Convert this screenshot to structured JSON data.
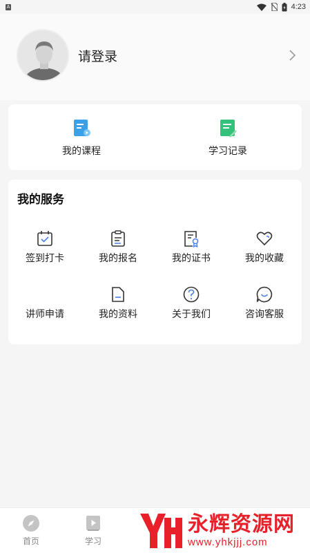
{
  "status_bar": {
    "notification_icon": "a-notification-icon",
    "time": "4:23"
  },
  "profile": {
    "login_label": "请登录",
    "avatar_icon": "avatar-person-icon",
    "chevron_icon": "chevron-right-icon"
  },
  "quick_actions": [
    {
      "label": "我的课程",
      "icon": "course-book-icon",
      "color": "#3aa0e8"
    },
    {
      "label": "学习记录",
      "icon": "study-note-icon",
      "color": "#34c27a"
    }
  ],
  "services": {
    "title": "我的服务",
    "items": [
      {
        "label": "签到打卡",
        "icon": "calendar-check-icon"
      },
      {
        "label": "我的报名",
        "icon": "clipboard-icon"
      },
      {
        "label": "我的证书",
        "icon": "certificate-icon"
      },
      {
        "label": "我的收藏",
        "icon": "heart-icon"
      },
      {
        "label": "讲师申请",
        "icon": ""
      },
      {
        "label": "我的资料",
        "icon": "folder-icon"
      },
      {
        "label": "关于我们",
        "icon": "question-circle-icon"
      },
      {
        "label": "咨询客服",
        "icon": "chat-bubble-icon"
      }
    ],
    "accent": "#4a7ee8"
  },
  "tabbar": {
    "tabs": [
      {
        "label": "首页",
        "icon": "compass-icon"
      },
      {
        "label": "学习",
        "icon": "play-book-icon"
      }
    ]
  },
  "watermark": {
    "title": "永辉资源网",
    "url": "www.yhkjjj.com",
    "color": "#e8202a"
  }
}
